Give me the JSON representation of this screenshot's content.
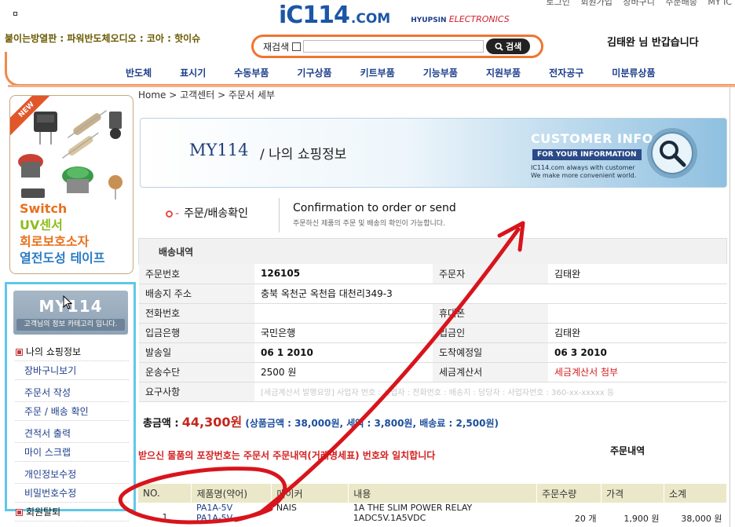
{
  "header": {
    "top_links": [
      "로그인",
      "회원가입",
      "장바구니",
      "주문배송",
      "MY IC"
    ],
    "logo_main": "iC114",
    "logo_com": ".COM",
    "partner": "HYUPSIN",
    "partner_sub": "ELECTRONICS",
    "marquee": "붙이는방열판 : 파워반도체오디오 : 코아 : 핫이슈",
    "welcome": "김태완 님 반갑습니다",
    "search": {
      "label": "재검색",
      "button": "검색"
    },
    "nav": [
      "반도체",
      "표시기",
      "수동부품",
      "기구상품",
      "키트부품",
      "기능부품",
      "지원부품",
      "전자공구",
      "미분류상품"
    ]
  },
  "banner": {
    "ribbon": "NEW",
    "lines": [
      "Switch",
      "UV센서",
      "회로보호소자",
      "열전도성 테이프"
    ]
  },
  "sidebar": {
    "title": "MY114",
    "subtitle": "고객님의 정보 카테고리 입니다.",
    "items": [
      "나의 쇼핑정보",
      "장바구니보기",
      "주문서 작성",
      "주문 / 배송 확인",
      "견적서 출력",
      "마이 스크랩",
      "개인정보수정",
      "비밀번호수정",
      "회원탈퇴"
    ]
  },
  "breadcrumb": "Home > 고객센터 > 주문서 세부",
  "hero": {
    "title": "MY114",
    "subtitle": "/ 나의 쇼핑정보",
    "customer_info": "CUSTOMER INFO",
    "for_your": "FOR YOUR INFORMATION",
    "desc1": "IC114.com always with customer",
    "desc2": "We make more convenient world."
  },
  "section": {
    "title": "주문/배송확인",
    "confirm_title": "Confirmation to order or send",
    "confirm_sub": "주문하신 제품의 주문 및 배송의 확인이 가능합니다."
  },
  "shipping": {
    "panel_title": "배송내역",
    "order_no_label": "주문번호",
    "order_no": "126105",
    "orderer_label": "주문자",
    "orderer": "김태완",
    "address_label": "배송지 주소",
    "address": "충북 옥천군 옥천읍 대천리349-3",
    "phone_label": "전화번호",
    "phone": "",
    "mobile_label": "휴대폰",
    "mobile": "",
    "bank_label": "입금은행",
    "bank": "국민은행",
    "depositor_label": "입금인",
    "depositor": "김태완",
    "ship_date_label": "발송일",
    "ship_date": "06 1 2010",
    "arrival_label": "도착예정일",
    "arrival": "06 3 2010",
    "method_label": "운송수단",
    "method": "2500 원",
    "invoice_label": "세금계산서",
    "invoice": "세금계산서 첨부",
    "request_label": "요구사항",
    "request": "[세금계산서 발행요망] 사업자 번호 : 사업자 : 전화번호 : 배송지 : 담당자 : 사업자번호 : 360-xx-xxxxx 등"
  },
  "total": {
    "label": "총금액 :",
    "amount": "44,300원",
    "breakdown": "(상품금액 : 38,000원, 세액 : 3,800원, 배송료 : 2,500원)"
  },
  "notice": "받으신 물품의 포장번호는 주문서 주문내역(거래명세표) 번호와 일치합니다",
  "order_items": {
    "heading": "주문내역",
    "columns": [
      "NO.",
      "제품명(약어)",
      "메이커",
      "내용",
      "주문수량",
      "가격",
      "소계"
    ],
    "rows": [
      {
        "no": "1",
        "part1": "PA1A-5V",
        "part2": "PA1A-5V",
        "maker": "NAIS",
        "desc1": "1A THE SLIM POWER RELAY",
        "desc2": "1ADC5V.1A5VDC",
        "qty": "20 개",
        "price": "1,900 원",
        "subtotal": "38,000 원"
      }
    ]
  },
  "colors": {
    "accent_orange": "#f07430",
    "nav_blue": "#1d3e8c",
    "alert_red": "#d42020",
    "annotation_red": "#d8141c"
  }
}
